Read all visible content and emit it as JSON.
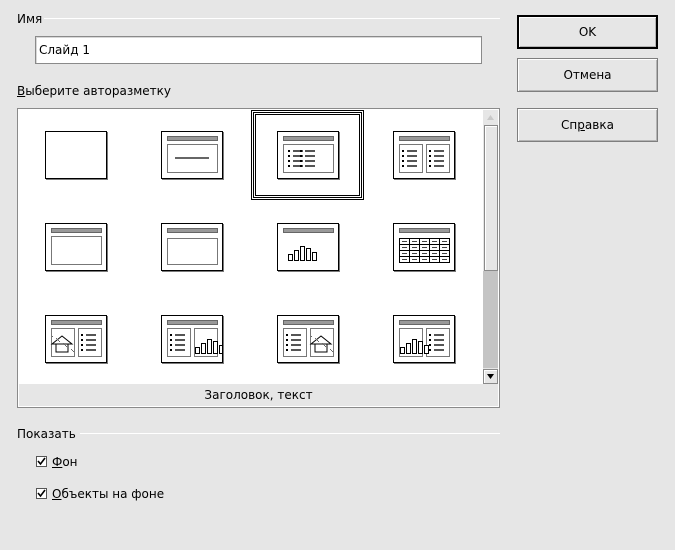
{
  "name_section": {
    "label": "Имя",
    "value": "Слайд 1"
  },
  "layout_section": {
    "label_accel": "В",
    "label_rest": "ыберите авторазметку",
    "selected_caption": "Заголовок, текст",
    "selected_index": 2,
    "layouts": [
      {
        "icon": "blank-layout-icon"
      },
      {
        "icon": "title-layout-icon"
      },
      {
        "icon": "title-content-layout-icon"
      },
      {
        "icon": "title-2-content-layout-icon"
      },
      {
        "icon": "title-only-layout-icon"
      },
      {
        "icon": "centered-text-layout-icon"
      },
      {
        "icon": "title-chart-layout-icon"
      },
      {
        "icon": "title-table-layout-icon"
      },
      {
        "icon": "title-clipart-text-layout-icon"
      },
      {
        "icon": "title-text-chart-layout-icon"
      },
      {
        "icon": "title-text-clipart-layout-icon"
      },
      {
        "icon": "title-chart-text-layout-icon"
      }
    ]
  },
  "buttons": {
    "ok": "OK",
    "cancel": "Отмена",
    "help_pre": "Сп",
    "help_accel": "р",
    "help_post": "авка"
  },
  "show_section": {
    "label": "Показать",
    "background_accel": "Ф",
    "background_rest": "он",
    "objects_accel": "О",
    "objects_rest": "бъекты на фоне",
    "background_checked": true,
    "objects_checked": true
  }
}
